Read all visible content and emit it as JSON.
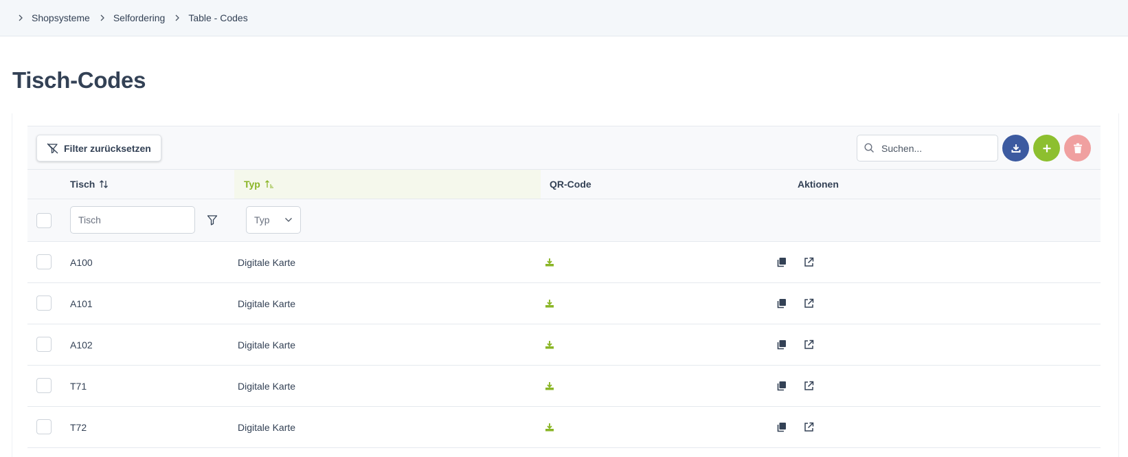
{
  "breadcrumb": [
    "Shopsysteme",
    "Selfordering",
    "Table - Codes"
  ],
  "page": {
    "title": "Tisch-Codes"
  },
  "toolbar": {
    "reset_label": "Filter zurücksetzen",
    "search_placeholder": "Suchen...",
    "buttons": [
      {
        "name": "download-button",
        "icon": "download-icon",
        "color": "#3c5aa0"
      },
      {
        "name": "add-button",
        "icon": "plus-icon",
        "color": "#8dbf2f"
      },
      {
        "name": "delete-button",
        "icon": "trash-icon",
        "color": "#f0a0a0"
      }
    ]
  },
  "table": {
    "columns": {
      "tisch": "Tisch",
      "typ": "Typ",
      "qr": "QR-Code",
      "aktionen": "Aktionen"
    },
    "sort": {
      "column": "typ",
      "direction": "ascending"
    },
    "filters": {
      "tisch_placeholder": "Tisch",
      "typ_placeholder": "Typ"
    },
    "rows": [
      {
        "tisch": "A100",
        "typ": "Digitale Karte"
      },
      {
        "tisch": "A101",
        "typ": "Digitale Karte"
      },
      {
        "tisch": "A102",
        "typ": "Digitale Karte"
      },
      {
        "tisch": "T71",
        "typ": "Digitale Karte"
      },
      {
        "tisch": "T72",
        "typ": "Digitale Karte"
      }
    ]
  },
  "colors": {
    "accent_green": "#8ab526",
    "text": "#334155",
    "download_blue": "#3c5aa0",
    "add_green": "#8dbf2f",
    "delete_red": "#f0a0a0"
  }
}
